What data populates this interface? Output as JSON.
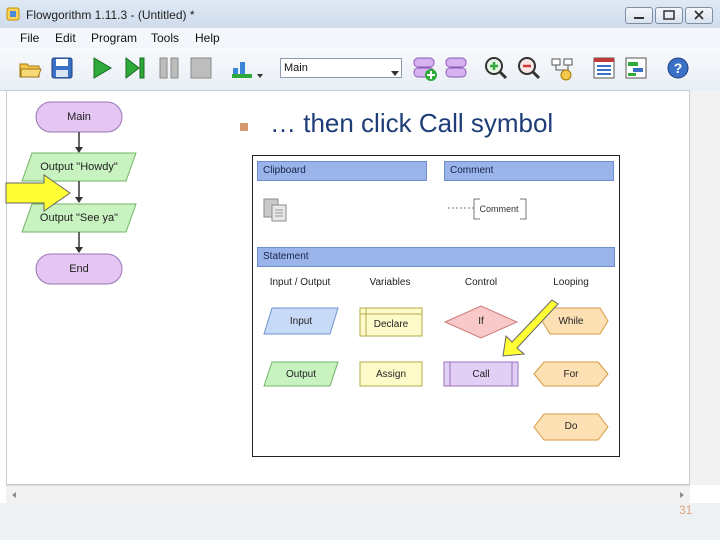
{
  "window": {
    "title": "Flowgorithm 1.11.3 - (Untitled) *"
  },
  "menu": [
    "File",
    "Edit",
    "Program",
    "Tools",
    "Help"
  ],
  "toolbar": {
    "function_select": "Main",
    "icons": [
      "open-folder-icon",
      "save-icon",
      "run-icon",
      "step-icon",
      "pause-icon",
      "stop-icon",
      "chart-icon",
      "dropdown-arrow-icon",
      "add-function-icon",
      "remove-function-icon",
      "zoom-in-icon",
      "zoom-out-icon",
      "layout-icon",
      "variable-watch-icon",
      "console-icon",
      "help-icon"
    ]
  },
  "flowchart": {
    "main": "Main",
    "output1": "Output \"Howdy\"",
    "output2": "Output \"See ya\"",
    "end": "End"
  },
  "slide": {
    "text": "… then click Call symbol",
    "page_number": "31"
  },
  "panel": {
    "clipboard": "Clipboard",
    "comment_header": "Comment",
    "comment_item": "Comment",
    "statement": "Statement",
    "categories": [
      "Input / Output",
      "Variables",
      "Control",
      "Looping"
    ],
    "items": {
      "input": "Input",
      "output": "Output",
      "declare": "Declare",
      "assign": "Assign",
      "if": "If",
      "call": "Call",
      "while": "While",
      "for": "For",
      "do": "Do"
    }
  },
  "colors": {
    "terminal": "#e5c6f2",
    "output": "#c8f2c0",
    "input": "#c7daf7",
    "variable": "#fdfbc9",
    "control": "#f9c8c8",
    "call": "#e2cff5",
    "loop": "#fde1b5",
    "arrow_highlight": "#ffff33",
    "header": "#9ab4ea",
    "slide_text": "#1d3c78"
  }
}
